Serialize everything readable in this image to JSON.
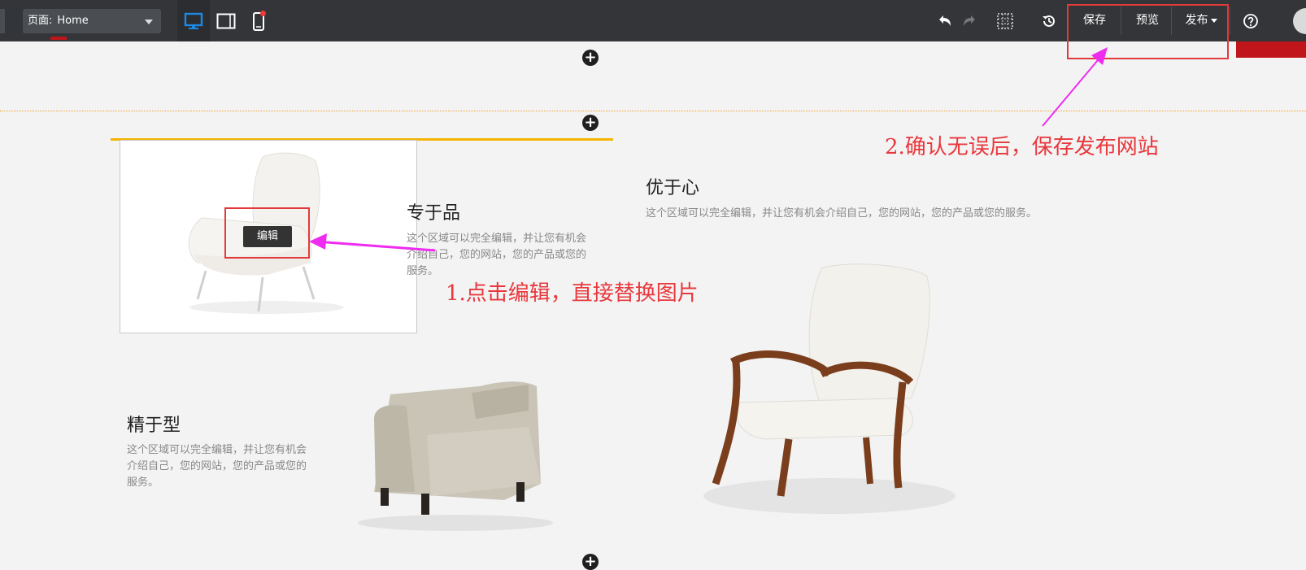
{
  "toolbar": {
    "page_select_label": "页面:",
    "page_select_value": "Home",
    "save_label": "保存",
    "preview_label": "预览",
    "publish_label": "发布"
  },
  "sections": {
    "feature_top": {
      "title": "专于品",
      "text": "这个区域可以完全编辑，并让您有机会介绍自己，您的网站，您的产品或您的服务。"
    },
    "feature_right": {
      "title": "优于心",
      "text": "这个区域可以完全编辑，并让您有机会介绍自己，您的网站，您的产品或您的服务。"
    },
    "feature_bottom": {
      "title": "精于型",
      "text": "这个区域可以完全编辑，并让您有机会介绍自己，您的网站，您的产品或您的服务。"
    }
  },
  "edit_button_label": "编辑",
  "annotations": {
    "step1": "1.点击编辑，直接替换图片",
    "step2": "2.确认无误后，保存发布网站"
  },
  "colors": {
    "toolbar_bg": "#333538",
    "accent_blue": "#1e88e5",
    "annotation_red": "#e8383d",
    "arrow_magenta": "#ee2cf0",
    "divider_orange": "#f3a230",
    "highlight_yellow": "#f6b400",
    "brand_red": "#c0161b"
  },
  "icons": [
    "desktop-icon",
    "tablet-icon",
    "mobile-icon",
    "undo-icon",
    "redo-icon",
    "grid-icon",
    "history-icon",
    "help-icon",
    "add-section-icon"
  ]
}
